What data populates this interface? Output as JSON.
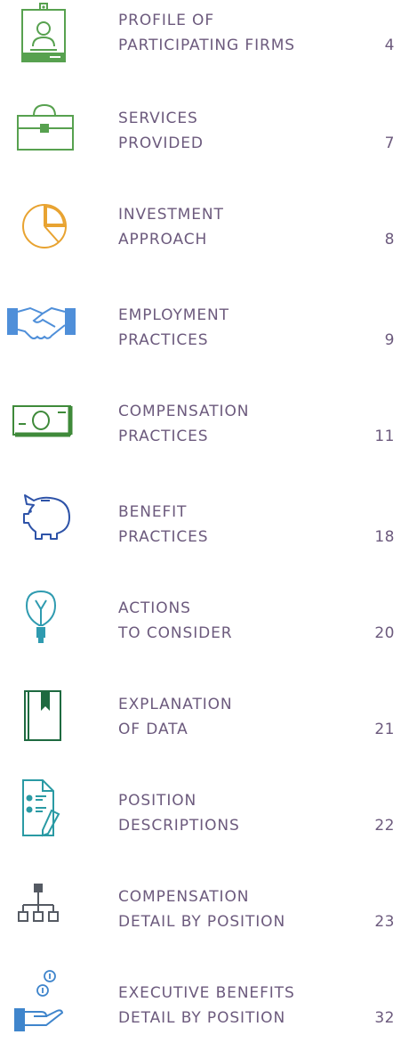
{
  "entries": [
    {
      "line1": "PROFILE OF",
      "line2": "PARTICIPATING FIRMS",
      "page": "4",
      "icon": "id-badge-icon"
    },
    {
      "line1": "SERVICES",
      "line2": "PROVIDED",
      "page": "7",
      "icon": "briefcase-icon"
    },
    {
      "line1": "INVESTMENT",
      "line2": "APPROACH",
      "page": "8",
      "icon": "pie-chart-icon"
    },
    {
      "line1": "EMPLOYMENT",
      "line2": "PRACTICES",
      "page": "9",
      "icon": "handshake-icon"
    },
    {
      "line1": "COMPENSATION",
      "line2": "PRACTICES",
      "page": "11",
      "icon": "banknote-icon"
    },
    {
      "line1": "BENEFIT",
      "line2": "PRACTICES",
      "page": "18",
      "icon": "piggy-bank-icon"
    },
    {
      "line1": "ACTIONS",
      "line2": "TO CONSIDER",
      "page": "20",
      "icon": "lightbulb-icon"
    },
    {
      "line1": "EXPLANATION",
      "line2": "OF DATA",
      "page": "21",
      "icon": "book-icon"
    },
    {
      "line1": "POSITION",
      "line2": "DESCRIPTIONS",
      "page": "22",
      "icon": "checklist-icon"
    },
    {
      "line1": "COMPENSATION",
      "line2": "DETAIL BY POSITION",
      "page": "23",
      "icon": "org-chart-icon"
    },
    {
      "line1": "EXECUTIVE BENEFITS",
      "line2": "DETAIL BY POSITION",
      "page": "32",
      "icon": "hand-coins-icon"
    }
  ]
}
